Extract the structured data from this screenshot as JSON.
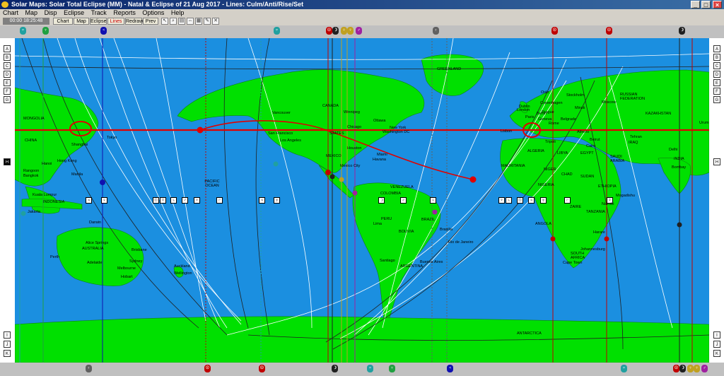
{
  "window": {
    "title": "Solar Maps: Solar Total Eclipse (MM) - Natal & Eclipse of 21 Aug 2017 - Lines: Culm/Anti/Rise/Set",
    "minimize": "_",
    "maximize": "□",
    "close": "×"
  },
  "menu": [
    "Chart",
    "Map",
    "Disp",
    "Eclipse",
    "Track",
    "Reports",
    "Options",
    "Help"
  ],
  "toolbar": {
    "datetime": "00:00 18:25:48",
    "buttons": [
      "Chart",
      "Map",
      "Eclipse",
      "Lines",
      "Redraw",
      "Prev"
    ],
    "icons": [
      "cursor-icon",
      "zoom-icon",
      "print-icon",
      "scale-icon",
      "grid-icon",
      "tools-icon",
      "close-map-icon"
    ]
  },
  "map": {
    "ocean_color": "#1b8fe0",
    "land_color": "#00e000",
    "eclipse_path_color": "#e00000",
    "labels": {
      "greenland": "GREENLAND",
      "canada": "CANADA",
      "winnipeg": "Winnipeg",
      "ottawa": "Ottawa",
      "chicago": "Chicago",
      "new_york": "New York",
      "washington": "Washington DC",
      "vancouver": "Vancouver",
      "san_francisco": "San Francisco",
      "los_angeles": "Los Angeles",
      "states": "STATES",
      "houston": "Houston",
      "mexico": "MEXICO",
      "mexico_city": "Mexico City",
      "miami": "Miami",
      "havana": "Havana",
      "pacific_ocean": "PACIFIC OCEAN",
      "venezuela": "VENEZUELA",
      "colombia": "COLOMBIA",
      "peru": "PERU",
      "lima": "Lima",
      "brazil": "BRAZIL",
      "brasilia": "Brasilia",
      "bolivia": "BOLIVIA",
      "rio": "Rio de Janeiro",
      "santiago": "Santiago",
      "argentina": "ARGENTINA",
      "buenos_aires": "Buenos Aires",
      "antarctica": "ANTARCTICA",
      "mongolia": "MONGOLIA",
      "china": "CHINA",
      "shanghai": "Shanghai",
      "tokyo": "Tokyo",
      "hanoi": "Hanoi",
      "hong_kong": "Hong Kong",
      "rangoon": "Rangoon",
      "bangkok": "Bangkok",
      "manila": "Manila",
      "kuala_lumpur": "Kuala Lumpur",
      "indonesia": "INDONESIA",
      "jakarta": "Jakarta",
      "darwin": "Darwin",
      "australia": "AUSTRALIA",
      "alice_springs": "Alice Springs",
      "brisbane": "Brisbane",
      "perth": "Perth",
      "adelaide": "Adelaide",
      "sydney": "Sydney",
      "melbourne": "Melbourne",
      "hobart": "Hobart",
      "auckland": "Auckland",
      "wellington": "Wellington",
      "oslo": "Oslo",
      "stockholm": "Stockholm",
      "copenhagen": "Copenhagen",
      "dublin": "Dublin",
      "london": "London",
      "berlin": "Berlin",
      "paris": "Paris",
      "prague": "Prague",
      "moscow": "Moscow",
      "minsk": "Minsk",
      "russian_fed": "RUSSIAN FEDERATION",
      "kazakhstan": "KAZAKHSTAN",
      "lisbon": "Lisbon",
      "geneva": "Geneva",
      "rome": "Rome",
      "belgrade": "Belgrade",
      "athens": "Athens",
      "tehran": "Tehran",
      "iraq": "IRAQ",
      "beirut": "Beirut",
      "cairo": "Cairo",
      "saudi": "SAUDI ARABIA",
      "delhi": "Delhi",
      "bombay": "Bombay",
      "india": "INDIA",
      "tripoli": "Tripoli",
      "algeria": "ALGERIA",
      "libya": "LIBYA",
      "egypt": "EGYPT",
      "mauritania": "MAURITANIA",
      "niger": "NIGER",
      "chad": "CHAD",
      "sudan": "SUDAN",
      "nigeria": "NIGERIA",
      "ethiopia": "ETHIOPIA",
      "zaire": "ZAIRE",
      "tanzania": "TANZANIA",
      "nairobi": "Nairobi",
      "angola": "ANGOLA",
      "harare": "Harare",
      "south_africa": "SOUTH AFRICA",
      "johannesburg": "Johannesburg",
      "cape_town": "Cape Town",
      "mogadishu": "Mogadishu",
      "urumqi": "Urum"
    }
  }
}
